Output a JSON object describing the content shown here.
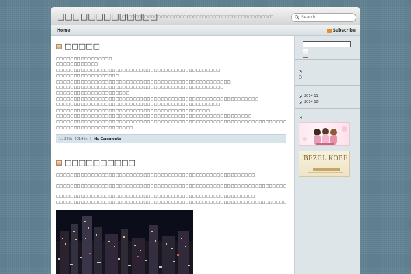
{
  "header": {
    "site_title": "□□□□□□□□□□□□□",
    "site_desc": "□□□□□□□□□□□□□□□□□□□□□□□□□□□□□□□□□□□□□□□□□□□□□□□□□",
    "search_placeholder": "Search"
  },
  "nav": {
    "home": "Home",
    "subscribe": "Subscribe"
  },
  "posts": [
    {
      "title": "□□□□□",
      "lines": [
        "□□□□□□□□□□□□□□□□",
        "□□□□□□□□□□□□",
        "□□□□□□□□□□□□□□□□□□□□□□□□□□□□□□□□□□□□□□□□□□□□□□□",
        "□□□□□□□□□□□□□□□□□□",
        "□□□□□□□□□□□□□□□□□□□□□□□□□□□□□□□□□□□□□□□□□□□□□□□□□□",
        "□□□□□□□□□□□□□□□□□□□□□□□□□□□□□□□□□□□□□□□□□□□□□□□□",
        "□□□□□□□□□□□□□□□□□□□□□",
        "□□□□□□□□□□□□□□□□□□□□□□□□□□□□□□□□□□□□□□□□□□□□□□□□□□□□□□□□□□",
        "□□□□□□□□□□□□□□□□□□□□□□□□□□□□□□□□□□□□□□□□□□□□□□□",
        "□□□□□□□□□□□□□□□□□□□□□□□□□□□□□□□□□□□□□□□□□□□□",
        "□□□□□□□□□□□□□□□□□□□□□□□□□□□□□□□□□□□□□□□□□□□□□□□□□□□□□□□□",
        "□□□□□□□□□□□□□□□□□□□□□□□□□□□□□□□□□□□□□□□□□□□□□□□□□□□□□□□□□□□□□□□□□□",
        "□□□□□□□□□□□□□□□□□□□□□□"
      ],
      "date": "11  27th, 2014 in",
      "comments": "No Comments"
    },
    {
      "title": "□□□□□□□□□□",
      "lines": [
        "□□□□□□□□□□□□□□□□□□□□□□□□□□□□□□□□□□□□□□□□□□□□□□□□□□□□□□□□□",
        "□□□□□□□□□□□□□□□□□□□□□□□□□□□□□□□□□□□□□□□□□□□□□□□□□□□□□□□□□□□□□□□□□□□□□□□□□□",
        "□□□□□□□□□□□□□□□□□□□□□□□□□□□□□□□□□□□□□□□□□□□□□□□□□□□□□□□□□",
        "□□□□□□□□□□□□□□□□□□□□□□□□□□□□□□□□□□□□□□□□□□□□□□□□□□□□□□□□□□□□□□□□□□□□□□□□□□□□□□□□□□□□□□□"
      ]
    }
  ],
  "sidebar": {
    "archives": [
      "2014 11",
      "2014 10"
    ],
    "banner2_text": "BEZEL KOBE"
  },
  "colors": {
    "background": "#5f7f8f",
    "meta_bar": "#d9e3ea",
    "sidebar": "#dde5e8"
  }
}
